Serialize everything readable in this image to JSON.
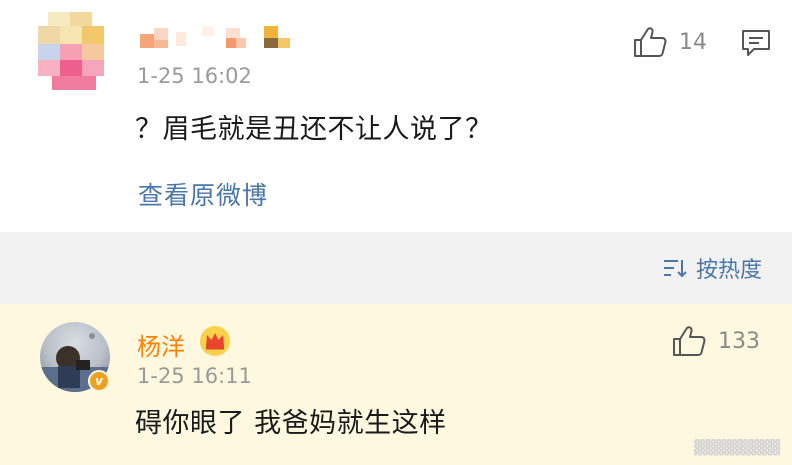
{
  "top_comment": {
    "time": "1-25 16:02",
    "text": "？眉毛就是丑还不让人说了？",
    "view_original": "查看原微博",
    "like_count": "14"
  },
  "sort": {
    "label": "按热度"
  },
  "reply_comment": {
    "username": "杨洋",
    "time": "1-25 16:11",
    "text": "碍你眼了 我爸妈就生这样",
    "like_count": "133"
  },
  "colors": {
    "link": "#4a76a8",
    "username": "#ff8200",
    "highlight_bg": "#fdf8df",
    "page_bg": "#f2f2f2"
  }
}
